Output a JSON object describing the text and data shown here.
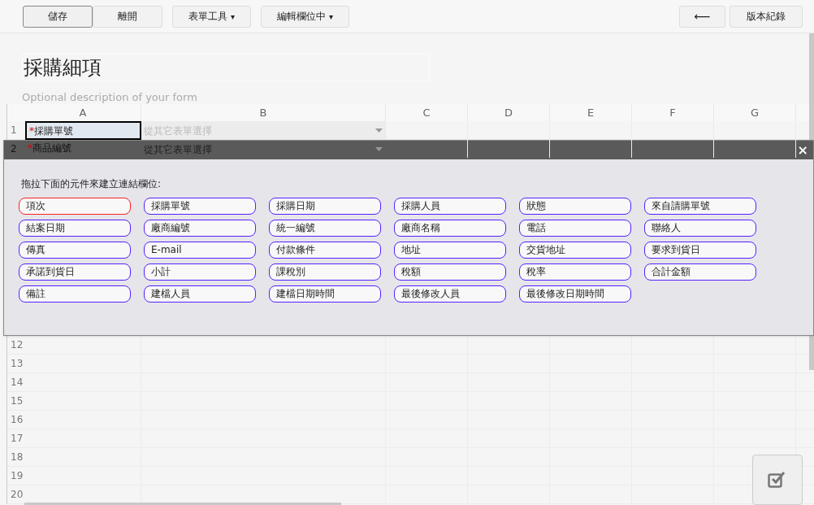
{
  "toolbar": {
    "left_buttons": [
      {
        "label": "儲存",
        "selected": true
      },
      {
        "label": "離開",
        "selected": false
      }
    ],
    "menus": [
      {
        "label": "表單工具",
        "caret": "▾"
      },
      {
        "label": "編輯欄位中",
        "caret": "▾"
      }
    ],
    "back_button": "⟵",
    "history_button": "版本紀錄"
  },
  "form": {
    "title": "採購細項",
    "description": "Optional description of your form"
  },
  "sheet": {
    "columns": [
      "A",
      "B",
      "C",
      "D",
      "E",
      "F",
      "G"
    ],
    "rows": [
      {
        "number": "1",
        "required": "*",
        "field": "採購單號",
        "source": "從其它表單選擇",
        "selected": true
      },
      {
        "number": "2",
        "required": "*",
        "field": "商品編號",
        "source": "從其它表單選擇",
        "selected": false
      }
    ],
    "empty_rows": [
      "12",
      "13",
      "14",
      "15",
      "16",
      "17",
      "18",
      "19",
      "20"
    ]
  },
  "panel": {
    "close": "×",
    "instruction": "拖拉下面的元件來建立連結欄位:",
    "chips": [
      {
        "label": "項次",
        "selected": true
      },
      {
        "label": "採購單號",
        "selected": false
      },
      {
        "label": "採購日期",
        "selected": false
      },
      {
        "label": "採購人員",
        "selected": false
      },
      {
        "label": "狀態",
        "selected": false
      },
      {
        "label": "來自請購單號",
        "selected": false
      },
      {
        "label": "結案日期",
        "selected": false
      },
      {
        "label": "廠商編號",
        "selected": false
      },
      {
        "label": "統一編號",
        "selected": false
      },
      {
        "label": "廠商名稱",
        "selected": false
      },
      {
        "label": "電話",
        "selected": false
      },
      {
        "label": "聯絡人",
        "selected": false
      },
      {
        "label": "傳真",
        "selected": false
      },
      {
        "label": "E-mail",
        "selected": false
      },
      {
        "label": "付款條件",
        "selected": false
      },
      {
        "label": "地址",
        "selected": false
      },
      {
        "label": "交貨地址",
        "selected": false
      },
      {
        "label": "要求到貨日",
        "selected": false
      },
      {
        "label": "承諾到貨日",
        "selected": false
      },
      {
        "label": "小計",
        "selected": false
      },
      {
        "label": "課稅別",
        "selected": false
      },
      {
        "label": "稅額",
        "selected": false
      },
      {
        "label": "稅率",
        "selected": false
      },
      {
        "label": "合計金額",
        "selected": false
      },
      {
        "label": "備註",
        "selected": false
      },
      {
        "label": "建檔人員",
        "selected": false
      },
      {
        "label": "建檔日期時間",
        "selected": false
      },
      {
        "label": "最後修改人員",
        "selected": false
      },
      {
        "label": "最後修改日期時間",
        "selected": false
      }
    ]
  }
}
